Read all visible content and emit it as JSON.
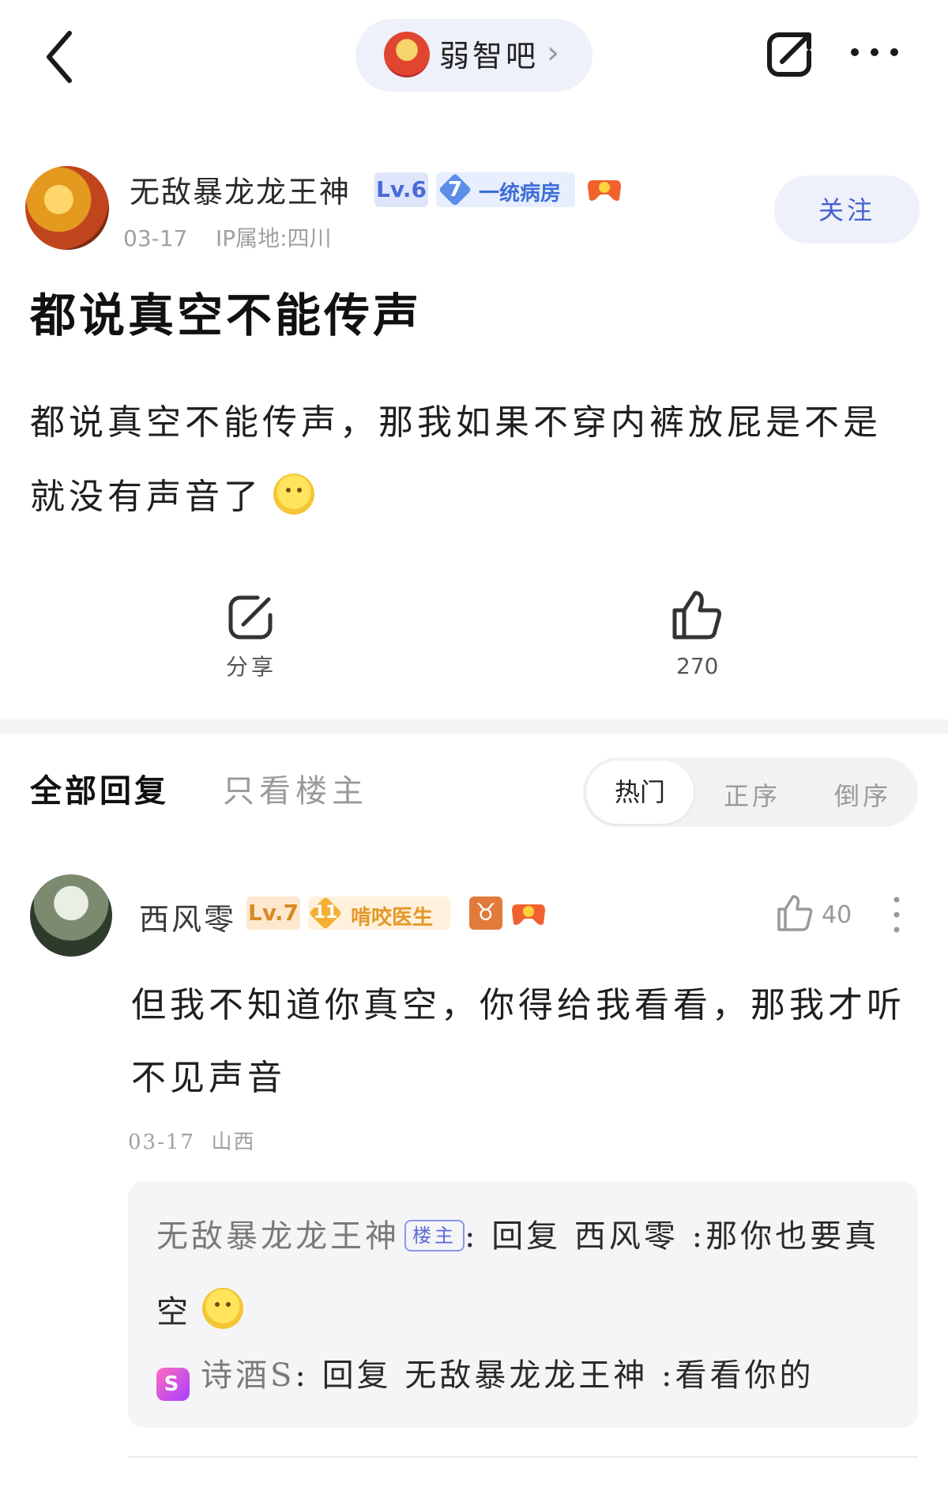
{
  "topbar": {
    "forum_name": "弱智吧",
    "chevron": "›"
  },
  "post": {
    "author": "无敌暴龙龙王神",
    "level": "Lv.6",
    "title_badge_num": "7",
    "title_badge_text": "一统病房",
    "date": "03-17",
    "ip": "IP属地:四川",
    "follow_label": "关注",
    "title": "都说真空不能传声",
    "body": "都说真空不能传声，那我如果不穿内裤放屁是不是就没有声音了",
    "share_label": "分享",
    "likes": "270"
  },
  "tabs": {
    "all": "全部回复",
    "op_only": "只看楼主",
    "sort_hot": "热门",
    "sort_asc": "正序",
    "sort_desc": "倒序"
  },
  "reply": {
    "name": "西风零",
    "level": "Lv.7",
    "title_badge_num": "11",
    "title_badge_text": "啃咬医生",
    "zodiac": "♉",
    "likes": "40",
    "body": "但我不知道你真空，你得给我看看，那我才听不见声音",
    "date": "03-17",
    "location": "山西",
    "sub_replies": [
      {
        "name": "无敌暴龙龙王神",
        "tag": "楼主",
        "sep": ":",
        "text": "回复 西风零 :那你也要真空"
      },
      {
        "icon": "S",
        "name": "诗酒S",
        "sep": ":",
        "text": "回复 无敌暴龙龙王神 :看看你的"
      }
    ]
  }
}
